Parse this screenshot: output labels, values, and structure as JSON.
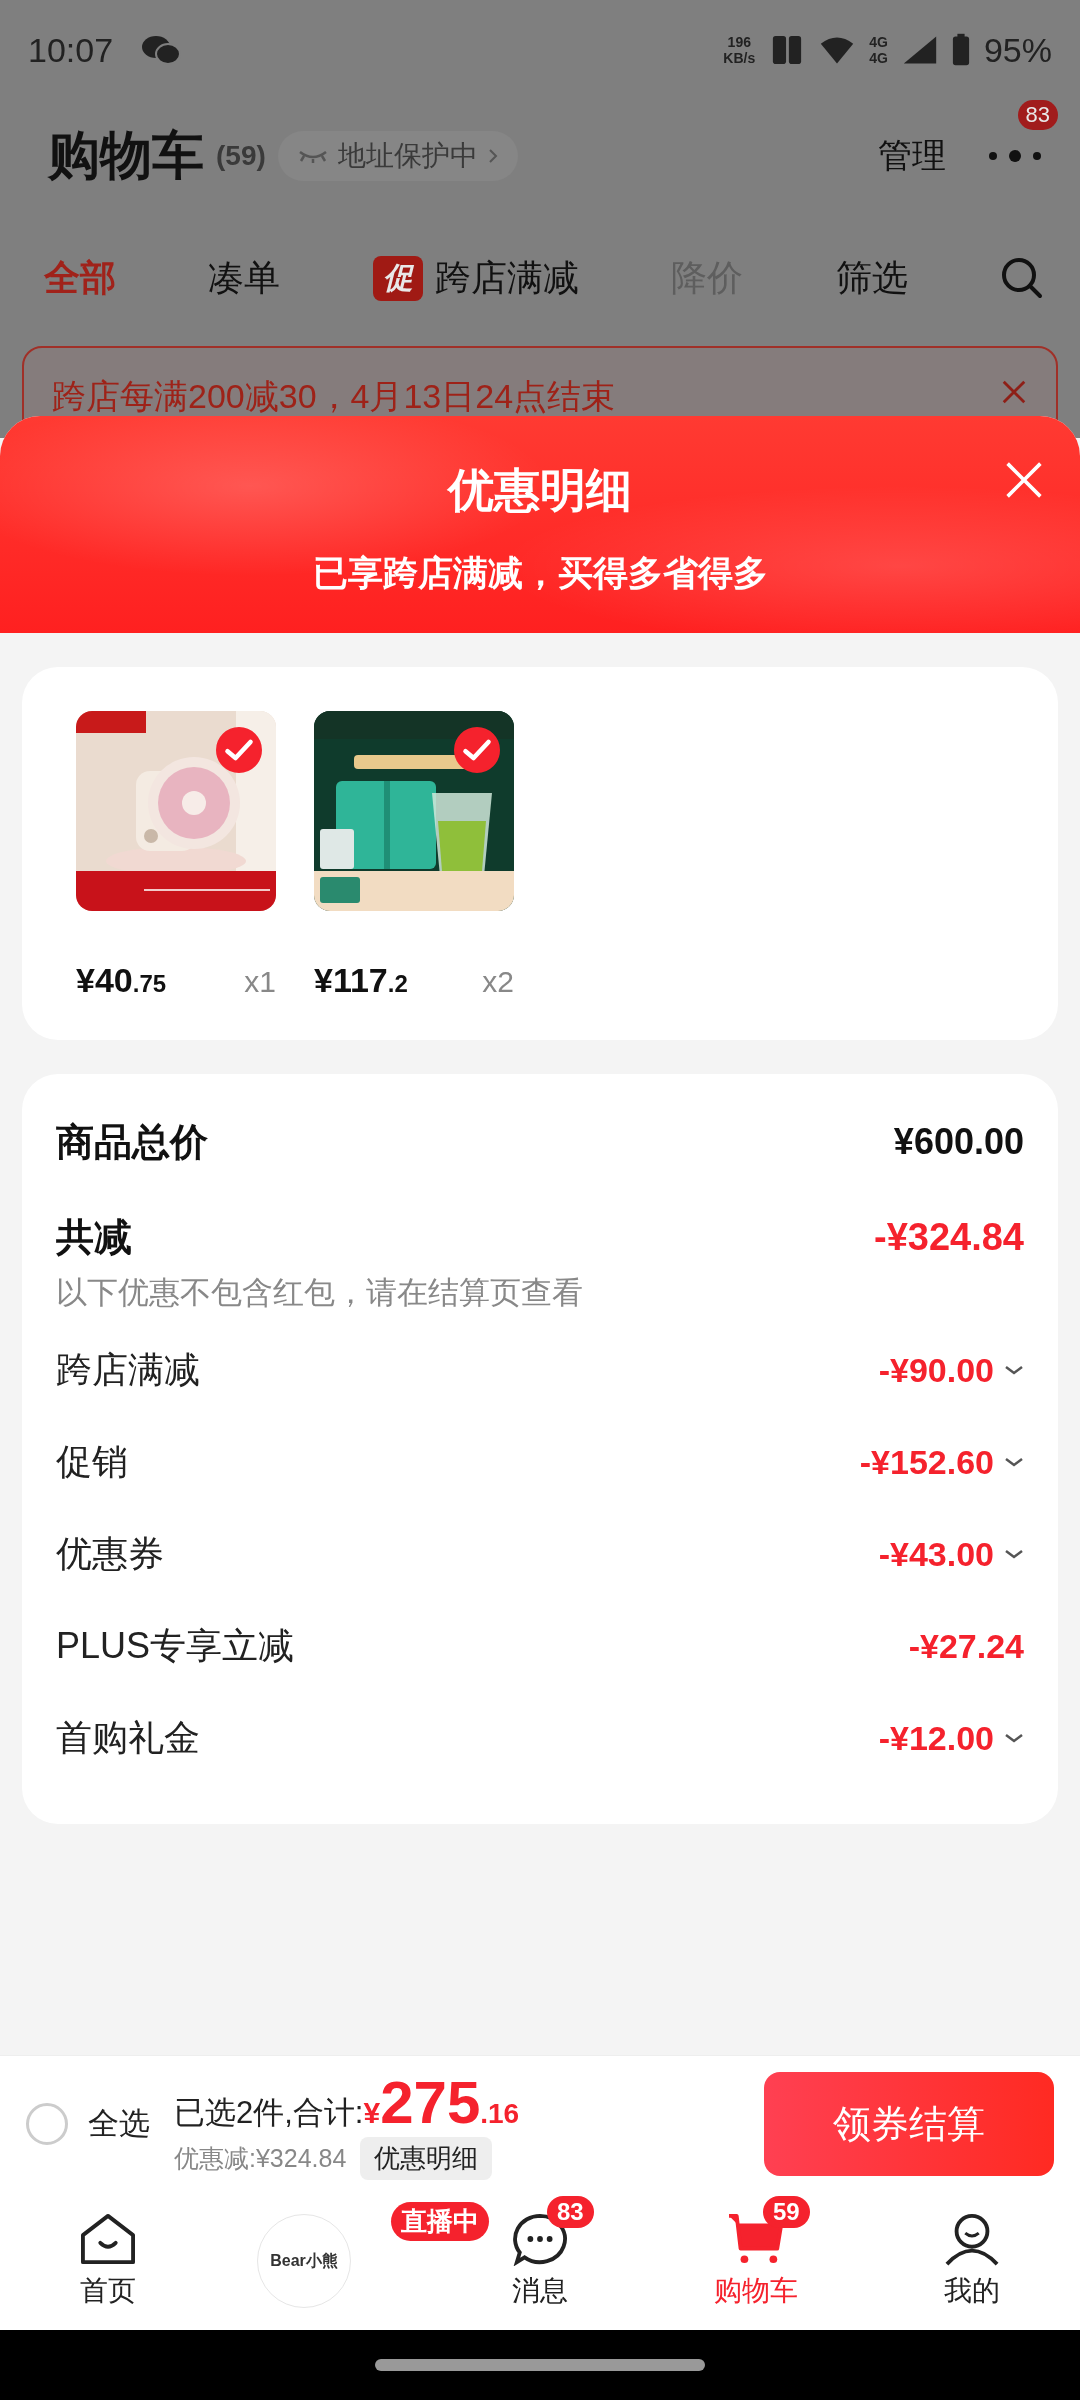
{
  "status_bar": {
    "time": "10:07",
    "net_speed": "196",
    "net_unit": "KB/s",
    "networks": [
      "4G",
      "4G"
    ],
    "battery": "95%"
  },
  "header": {
    "title": "购物车",
    "count": "(59)",
    "address_chip": "地址保护中",
    "manage": "管理",
    "more_badge": "83"
  },
  "tabs": [
    {
      "label": "全部",
      "selected": true,
      "disabled": false
    },
    {
      "label": "凑单",
      "selected": false,
      "disabled": false
    },
    {
      "label": "跨店满减",
      "selected": false,
      "disabled": false,
      "badge": "促"
    },
    {
      "label": "降价",
      "selected": false,
      "disabled": true
    },
    {
      "label": "筛选",
      "selected": false,
      "disabled": false
    }
  ],
  "banner": {
    "text": "跨店每满200减30，4月13日24点结束"
  },
  "sheet": {
    "title": "优惠明细",
    "subtitle": "已享跨店满减，买得多省得多",
    "products": [
      {
        "selected": true,
        "price_main": "¥40",
        "price_decimal": ".75",
        "quantity": "x1"
      },
      {
        "selected": true,
        "price_main": "¥117",
        "price_decimal": ".2",
        "quantity": "x2"
      }
    ],
    "total": {
      "label": "商品总价",
      "value": "¥600.00"
    },
    "reduction": {
      "label": "共减",
      "value": "-¥324.84",
      "note": "以下优惠不包含红包，请在结算页查看"
    },
    "discounts": [
      {
        "label": "跨店满减",
        "amount": "-¥90.00",
        "expandable": true
      },
      {
        "label": "促销",
        "amount": "-¥152.60",
        "expandable": true
      },
      {
        "label": "优惠券",
        "amount": "-¥43.00",
        "expandable": true
      },
      {
        "label": "PLUS专享立减",
        "amount": "-¥27.24",
        "expandable": false
      },
      {
        "label": "首购礼金",
        "amount": "-¥12.00",
        "expandable": true
      }
    ]
  },
  "checkout": {
    "select_all": {
      "label": "全选",
      "checked": false
    },
    "summary": "已选2件,合计:",
    "currency": "¥",
    "total_main": "275",
    "total_decimal": ".16",
    "saved": "优惠减:¥324.84",
    "detail_button": "优惠明细",
    "pay_button": "领券结算"
  },
  "bottom_nav": [
    {
      "kind": "home",
      "label": "首页",
      "selected": false
    },
    {
      "kind": "live",
      "logo": "Bear小熊",
      "badge": "直播中",
      "selected": false
    },
    {
      "kind": "message",
      "label": "消息",
      "badge": "83",
      "selected": false
    },
    {
      "kind": "cart",
      "label": "购物车",
      "badge": "59",
      "selected": true
    },
    {
      "kind": "profile",
      "label": "我的",
      "selected": false
    }
  ]
}
